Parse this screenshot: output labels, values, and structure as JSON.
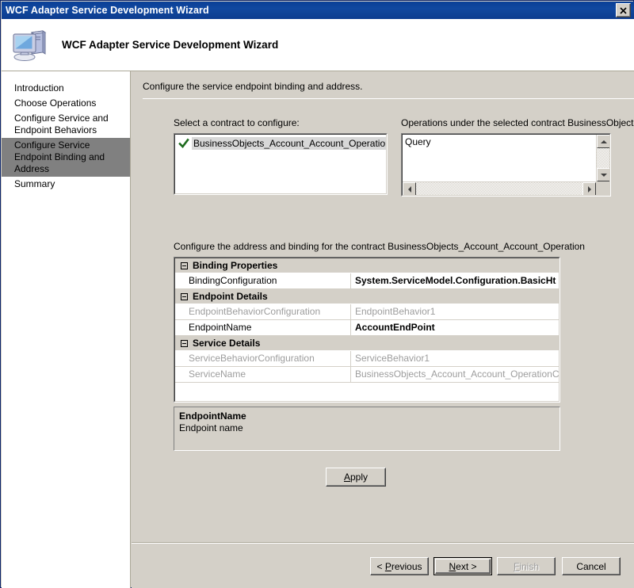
{
  "window": {
    "title": "WCF Adapter Service Development Wizard",
    "close_label": "✕"
  },
  "header": {
    "title": "WCF Adapter Service Development Wizard",
    "icon": "computer-icon"
  },
  "sidebar": {
    "items": [
      {
        "label": "Introduction",
        "selected": false
      },
      {
        "label": "Choose Operations",
        "selected": false
      },
      {
        "label": "Configure Service and Endpoint Behaviors",
        "selected": false
      },
      {
        "label": "Configure Service Endpoint Binding and Address",
        "selected": true
      },
      {
        "label": "Summary",
        "selected": false
      }
    ],
    "selected_index": 3
  },
  "main": {
    "step_banner": "Configure the service endpoint binding and address.",
    "contract_label": "Select a contract to configure:",
    "contract_items": [
      {
        "label": "BusinessObjects_Account_Account_Operation",
        "checked": true,
        "selected": true
      }
    ],
    "operations_label": "Operations under the selected contract  BusinessObjects_",
    "operations_items": [
      "Query"
    ],
    "grid_caption": "Configure the address and binding for the contract  BusinessObjects_Account_Account_Operation",
    "property_grid": [
      {
        "category": "Binding Properties",
        "expanded": true,
        "rows": [
          {
            "name": "BindingConfiguration",
            "value": "System.ServiceModel.Configuration.BasicHt",
            "bold": true,
            "disabled": false
          }
        ]
      },
      {
        "category": "Endpoint Details",
        "expanded": true,
        "rows": [
          {
            "name": "EndpointBehaviorConfiguration",
            "value": "EndpointBehavior1",
            "bold": false,
            "disabled": true
          },
          {
            "name": "EndpointName",
            "value": "AccountEndPoint",
            "bold": true,
            "disabled": false
          }
        ]
      },
      {
        "category": "Service Details",
        "expanded": true,
        "rows": [
          {
            "name": "ServiceBehaviorConfiguration",
            "value": "ServiceBehavior1",
            "bold": false,
            "disabled": true
          },
          {
            "name": "ServiceName",
            "value": "BusinessObjects_Account_Account_OperationClient",
            "bold": false,
            "disabled": true
          }
        ]
      }
    ],
    "description": {
      "title": "EndpointName",
      "body": "Endpoint name"
    },
    "apply_label_prefix": "",
    "apply_accel": "A",
    "apply_label_suffix": "pply"
  },
  "footer": {
    "previous": {
      "prefix": "< ",
      "accel": "P",
      "suffix": "revious",
      "disabled": false,
      "default": false
    },
    "next": {
      "prefix": "",
      "accel": "N",
      "suffix": "ext >",
      "disabled": false,
      "default": true
    },
    "finish": {
      "prefix": "",
      "accel": "F",
      "suffix": "inish",
      "disabled": true,
      "default": false
    },
    "cancel": {
      "prefix": "",
      "accel": "",
      "suffix": "Cancel",
      "disabled": false,
      "default": false
    }
  },
  "colors": {
    "titlebar": "#0a3f96",
    "face": "#d4d0c8",
    "selection": "#808080",
    "listbox_selection": "#d8d8d8",
    "check": "#1e6b1e",
    "disabled_text": "#9d9d9d"
  }
}
